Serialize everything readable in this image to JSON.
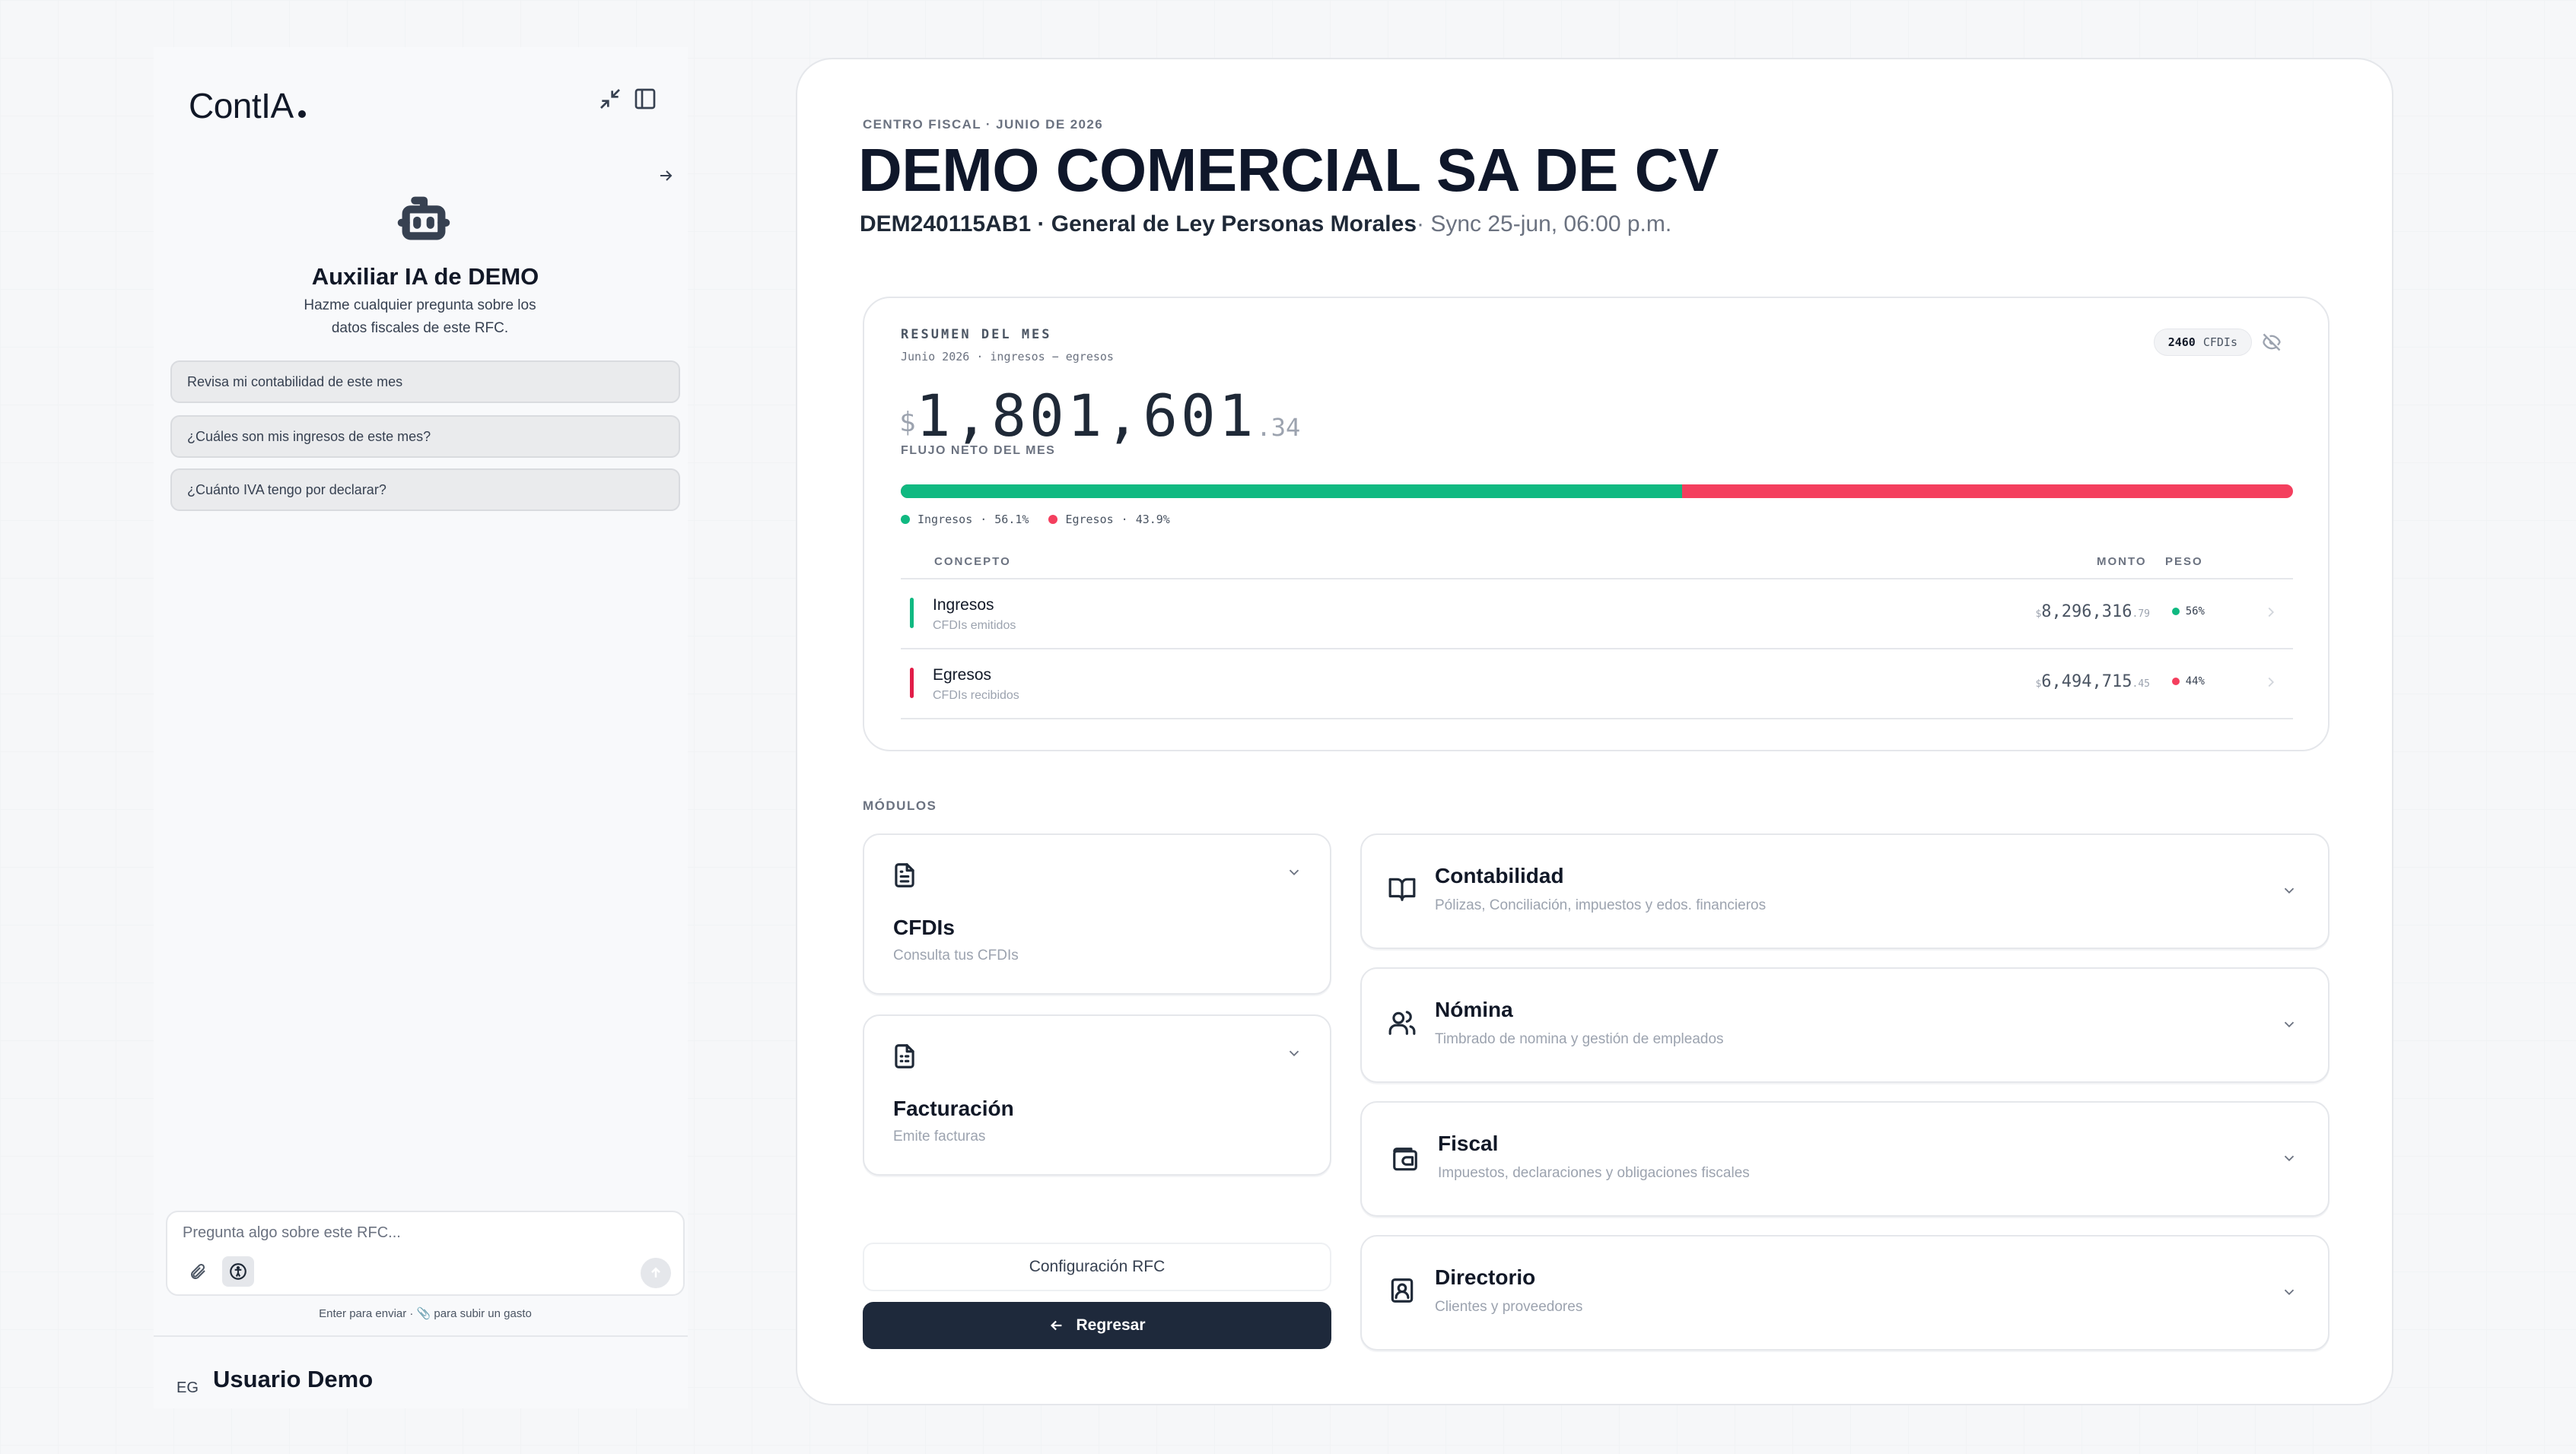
{
  "sidebar": {
    "logo": "ContIA",
    "assistant_title": "Auxiliar IA de DEMO",
    "assistant_subtitle": "Hazme cualquier pregunta sobre los datos fiscales de este RFC.",
    "prompts": [
      "Revisa mi contabilidad de este mes",
      "¿Cuáles son mis ingresos de este mes?",
      "¿Cuánto IVA tengo por declarar?"
    ],
    "chat_placeholder": "Pregunta algo sobre este RFC...",
    "chat_hint": "Enter para enviar · 📎 para subir un gasto",
    "user_initials": "EG",
    "user_name": "Usuario Demo"
  },
  "header": {
    "eyebrow": "CENTRO FISCAL · JUNIO DE 2026",
    "company": "DEMO COMERCIAL SA DE CV",
    "rfc_regime": "DEM240115AB1 · General de Ley Personas Morales",
    "sync": "· Sync 25-jun, 06:00 p.m."
  },
  "summary": {
    "title": "RESUMEN DEL MES",
    "meta": "Junio 2026 · ingresos − egresos",
    "cfdi_count": "2460",
    "cfdi_label": "CFDIs",
    "currency": "$",
    "amount_main": "1,801,601",
    "amount_cents": ".34",
    "amount_label": "FLUJO NETO DEL MES",
    "income_share": 0.561,
    "colors": {
      "income": "#10b981",
      "expense": "#f43f5e"
    },
    "legend": [
      {
        "label": "Ingresos",
        "pct": "56.1%"
      },
      {
        "label": "Egresos",
        "pct": "43.9%"
      }
    ],
    "columns": {
      "concept": "CONCEPTO",
      "amount": "MONTO",
      "weight": "PESO"
    },
    "rows": [
      {
        "name": "Ingresos",
        "sub": "CFDIs emitidos",
        "currency": "$",
        "amount": "8,296,316",
        "cents": ".79",
        "pct": "56%"
      },
      {
        "name": "Egresos",
        "sub": "CFDIs recibidos",
        "currency": "$",
        "amount": "6,494,715",
        "cents": ".45",
        "pct": "44%"
      }
    ]
  },
  "modules": {
    "label": "MÓDULOS",
    "cfdis": {
      "title": "CFDIs",
      "desc": "Consulta tus CFDIs",
      "icon": "document-icon"
    },
    "facturacion": {
      "title": "Facturación",
      "desc": "Emite facturas",
      "icon": "invoice-icon"
    },
    "contabilidad": {
      "title": "Contabilidad",
      "desc": "Pólizas, Conciliación, impuestos y edos. financieros",
      "icon": "book-icon"
    },
    "nomina": {
      "title": "Nómina",
      "desc": "Timbrado de nomina y gestión de empleados",
      "icon": "users-icon"
    },
    "fiscal": {
      "title": "Fiscal",
      "desc": "Impuestos, declaraciones y obligaciones fiscales",
      "icon": "wallet-icon"
    },
    "directorio": {
      "title": "Directorio",
      "desc": "Clientes y proveedores",
      "icon": "contact-book-icon"
    }
  },
  "actions": {
    "config": "Configuración RFC",
    "back": "Regresar"
  }
}
